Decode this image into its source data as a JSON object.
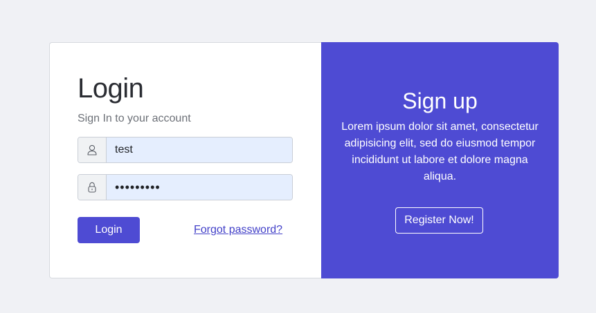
{
  "login": {
    "title": "Login",
    "subtitle": "Sign In to your account",
    "username": {
      "value": "test",
      "icon": "user-icon"
    },
    "password": {
      "value": "password1",
      "icon": "lock-icon"
    },
    "login_label": "Login",
    "forgot_label": "Forgot password?"
  },
  "signup": {
    "title": "Sign up",
    "text": "Lorem ipsum dolor sit amet, consectetur adipisicing elit, sed do eiusmod tempor incididunt ut labore et dolore magna aliqua.",
    "register_label": "Register Now!"
  },
  "colors": {
    "background": "#f0f1f5",
    "primary": "#4e4bd3",
    "input_fill": "#e5eefe",
    "link": "#4240c8"
  }
}
